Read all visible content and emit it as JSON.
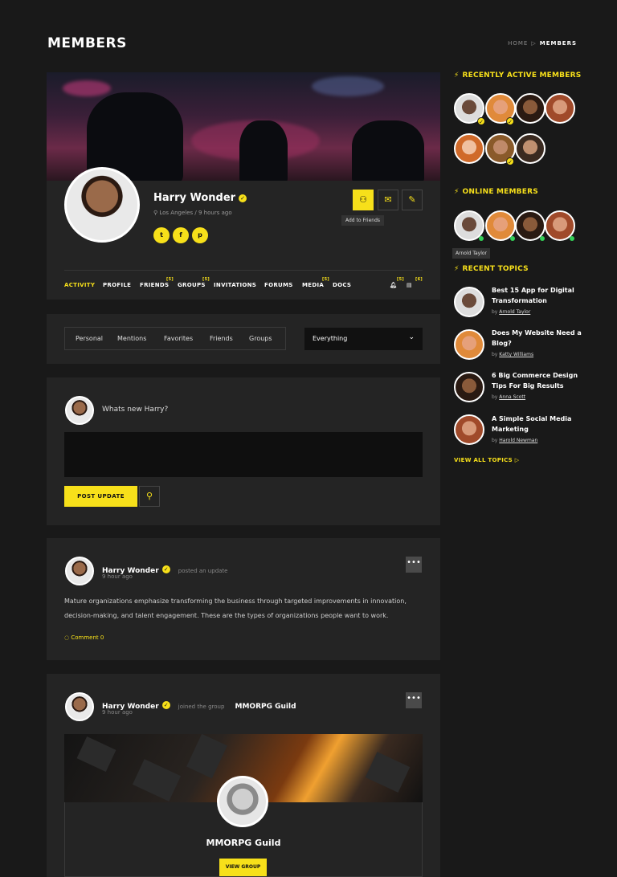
{
  "page": {
    "title": "MEMBERS"
  },
  "breadcrumb": {
    "home": "HOME",
    "sep": "▷",
    "current": "MEMBERS"
  },
  "profile": {
    "name": "Harry Wonder",
    "location": "Los Angeles",
    "last_seen": "9 hours ago",
    "tooltip": "Add to Friends",
    "social": [
      "twitter-icon",
      "facebook-icon",
      "pinterest-icon"
    ]
  },
  "tabs": [
    {
      "label": "ACTIVITY",
      "count": ""
    },
    {
      "label": "PROFILE",
      "count": ""
    },
    {
      "label": "FRIENDS",
      "count": "[5]"
    },
    {
      "label": "GROUPS",
      "count": "[5]"
    },
    {
      "label": "INVITATIONS",
      "count": ""
    },
    {
      "label": "FORUMS",
      "count": ""
    },
    {
      "label": "MEDIA",
      "count": "[5]"
    },
    {
      "label": "DOCS",
      "count": ""
    }
  ],
  "notifications": {
    "bell_count": "[5]",
    "messages_count": "[6]"
  },
  "filters": {
    "tabs": [
      "Personal",
      "Mentions",
      "Favorites",
      "Friends",
      "Groups"
    ],
    "select_value": "Everything"
  },
  "post_form": {
    "prompt": "Whats new Harry?",
    "submit_label": "POST UPDATE"
  },
  "activity": [
    {
      "author": "Harry Wonder",
      "action": "posted an update",
      "time": "9 hour ago",
      "text": "Mature organizations emphasize transforming the business through targeted improvements in innovation, decision-making, and talent engagement. These are the types of organizations people want to work.",
      "comment_label": "Comment 0"
    },
    {
      "author": "Harry Wonder",
      "action": "joined the group",
      "group": "MMORPG Guild",
      "time": "9 hour ago",
      "group_title": "MMORPG Guild",
      "view_label": "VIEW GROUP"
    }
  ],
  "sidebar": {
    "recent_title": "RECENTLY ACTIVE MEMBERS",
    "online_title": "ONLINE MEMBERS",
    "online_tooltip": "Arnold Taylor",
    "topics_title": "RECENT TOPICS",
    "topics": [
      {
        "title": "Best 15 App for Digital Transformation",
        "by": "by",
        "author": "Arnold Taylor"
      },
      {
        "title": "Does My Website Need a Blog?",
        "by": "by",
        "author": "Katty Williams"
      },
      {
        "title": "6 Big Commerce Design Tips For Big Results",
        "by": "by",
        "author": "Anna Scott"
      },
      {
        "title": "A Simple Social Media Marketing",
        "by": "by",
        "author": "Harold Newman"
      }
    ],
    "view_all_label": "VIEW ALL TOPICS",
    "view_all_icon": "▷"
  },
  "colors": {
    "accent": "#f7e01a",
    "bg": "#191919",
    "card": "#242424",
    "online": "#34d058"
  }
}
